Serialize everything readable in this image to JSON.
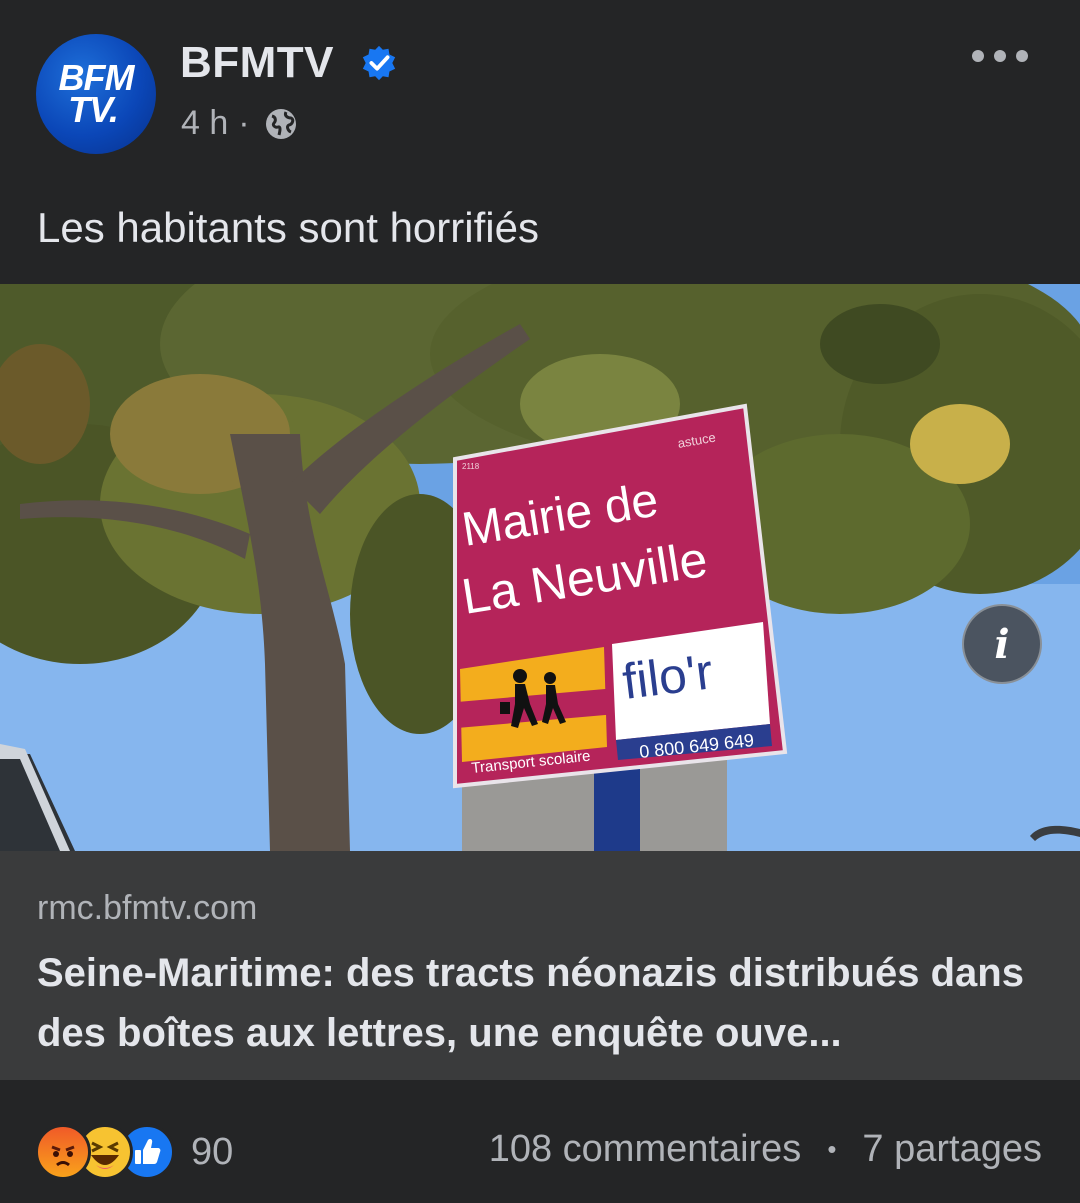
{
  "post": {
    "page_name": "BFMTV",
    "avatar_text_line1": "BFM",
    "avatar_text_line2": "TV.",
    "time": "4 h",
    "separator": "·",
    "caption": "Les habitants sont horrifiés"
  },
  "photo": {
    "sign_line1": "Mairie de",
    "sign_line2": "La Neuville",
    "sign_small_logo": "astuce",
    "sign_code": "2118",
    "transport_label": "Transport scolaire",
    "filor_label": "filo'r",
    "filor_phone": "0 800 649 649",
    "info_button": "i"
  },
  "link": {
    "domain": "rmc.bfmtv.com",
    "title": "Seine-Maritime: des tracts néonazis distribués dans des boîtes aux lettres, une enquête ouve..."
  },
  "footer": {
    "reaction_count": "90",
    "comments": "108 commentaires",
    "bullet": "•",
    "shares": "7 partages"
  },
  "colors": {
    "background": "#242526",
    "link_preview_bg": "#3a3b3c",
    "verified": "#1877f2",
    "sign_magenta": "#b5245a"
  },
  "icons": [
    "verified-badge-icon",
    "globe-icon",
    "more-options-icon",
    "info-icon",
    "angry-reaction-icon",
    "haha-reaction-icon",
    "like-reaction-icon"
  ]
}
